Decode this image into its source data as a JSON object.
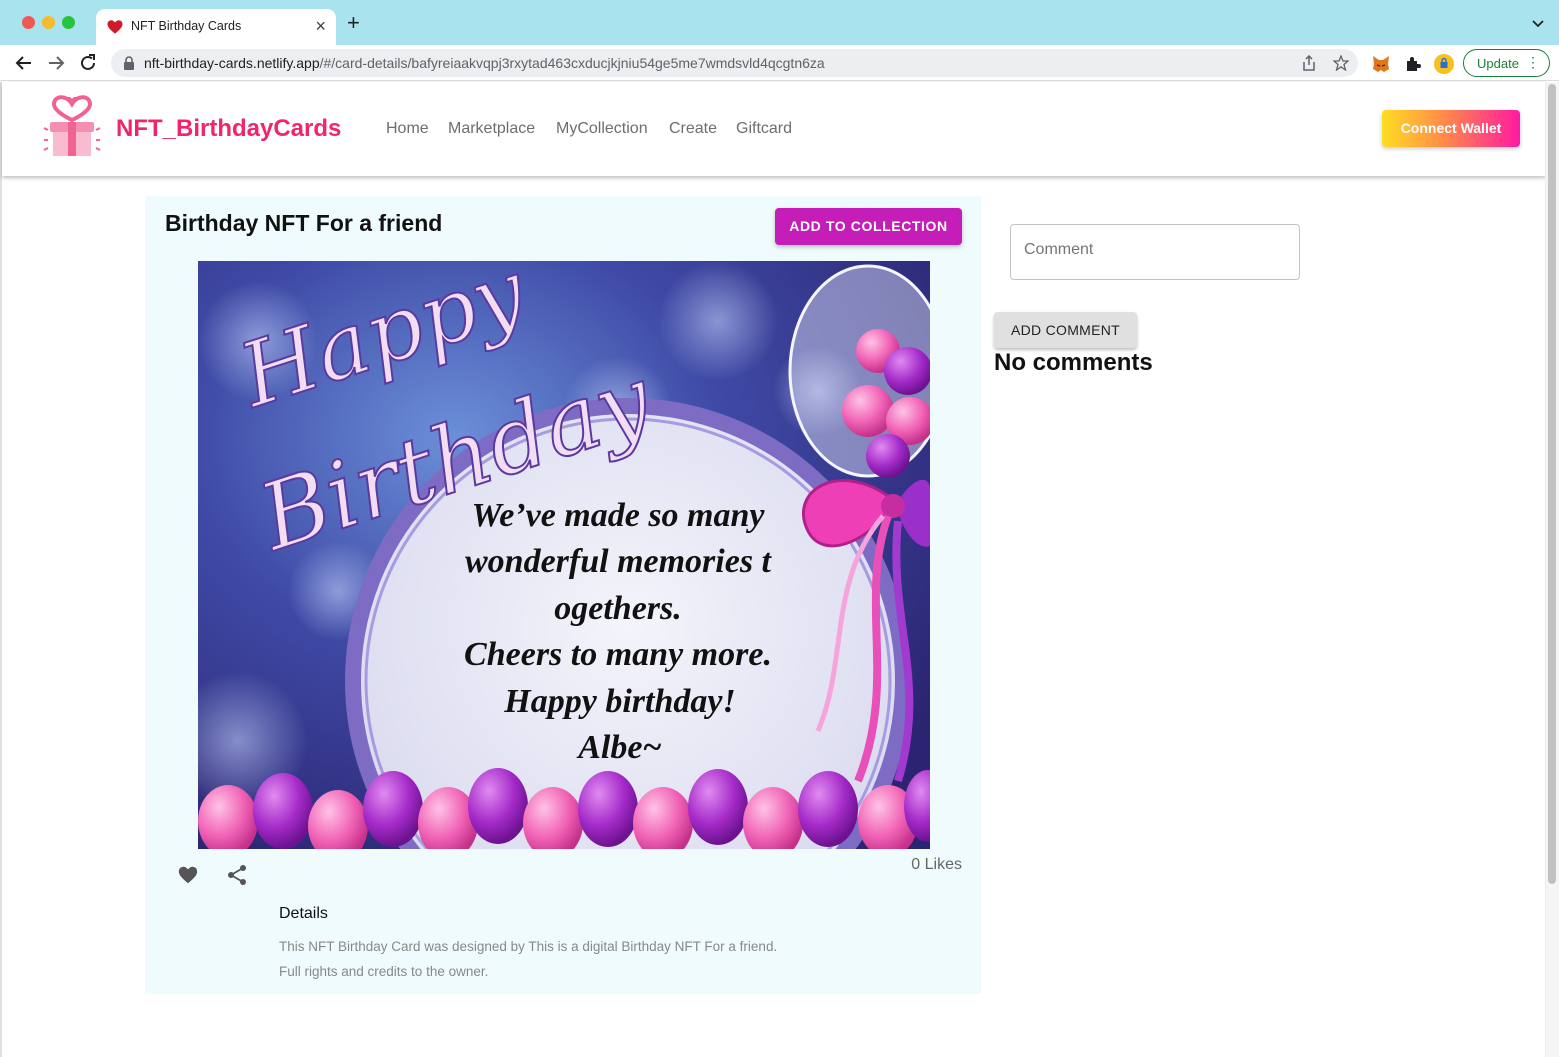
{
  "browser": {
    "tab_title": "NFT Birthday Cards",
    "url_host": "nft-birthday-cards.netlify.app",
    "url_path": "/#/card-details/bafyreiaakvqpj3rxytad463cxducjkjniu54ge5me7wmdsvld4qcgtn6za",
    "update_label": "Update",
    "icons": [
      "back-arrow-icon",
      "forward-arrow-icon",
      "reload-icon",
      "lock-icon",
      "share-page-icon",
      "bookmark-star-icon",
      "metamask-fox-icon",
      "extensions-puzzle-icon",
      "profile-icon",
      "more-vertical-icon"
    ]
  },
  "header": {
    "brand": "NFT_BirthdayCards",
    "nav": [
      "Home",
      "Marketplace",
      "MyCollection",
      "Create",
      "Giftcard"
    ],
    "connect_wallet": "Connect Wallet"
  },
  "card": {
    "title": "Birthday NFT For a friend",
    "add_to_collection": "ADD TO COLLECTION",
    "image_text": {
      "script_line1": "Happy",
      "script_line2": "Birthday",
      "message_lines": [
        "We’ve made so many",
        "wonderful memories t",
        "ogethers.",
        "Cheers to many more.",
        "Happy birthday!",
        "Albe~"
      ]
    },
    "likes": "0 Likes",
    "details_title": "Details",
    "details_line1": "This NFT Birthday Card was designed by This is a digital Birthday NFT For a friend.",
    "details_line2": "Full rights and credits to the owner."
  },
  "comments": {
    "placeholder": "Comment",
    "add_button": "ADD COMMENT",
    "empty_text": "No comments"
  },
  "colors": {
    "brand_pink": "#f0256e",
    "add_collection_magenta": "#c41db8",
    "panel_bg": "#f0fbfd",
    "titlebar": "#a8e3ee"
  }
}
